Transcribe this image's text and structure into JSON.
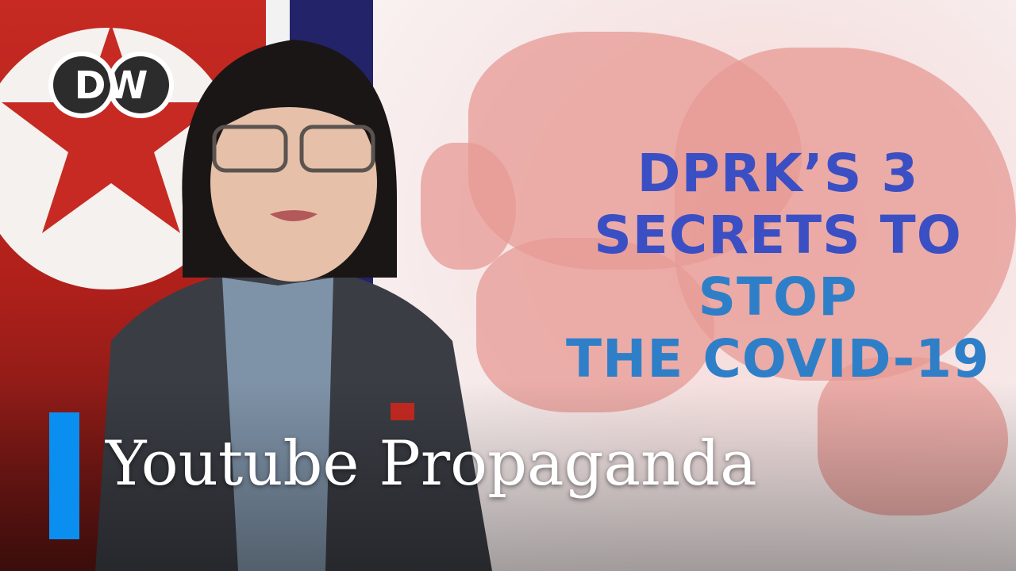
{
  "logo": {
    "text": "DW"
  },
  "headline": {
    "lines": [
      "DPRK’S 3",
      "SECRETS TO",
      "STOP",
      "THE COVID-19"
    ]
  },
  "caption": {
    "text": "Youtube Propaganda"
  },
  "colors": {
    "accent_bar": "#0a8ff0",
    "headline": "#3b4fc4",
    "flag_red": "#c62a22",
    "flag_blue": "#23236a"
  }
}
